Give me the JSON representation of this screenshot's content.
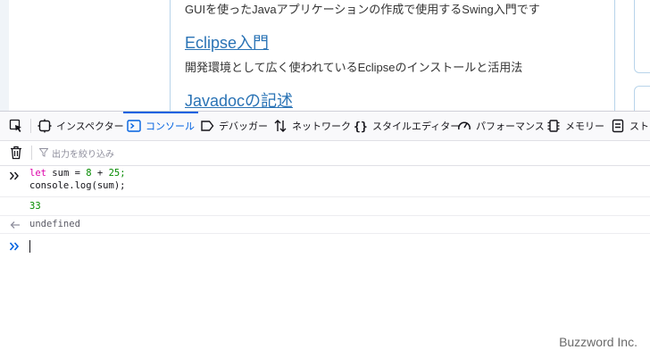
{
  "page": {
    "lines": [
      {
        "kind": "text",
        "value": "GUIを使ったJavaアプリケーションの作成で使用するSwing入門です"
      },
      {
        "kind": "link",
        "value": "Eclipse入門"
      },
      {
        "kind": "text",
        "value": "開発環境として広く使われているEclipseのインストールと活用法"
      },
      {
        "kind": "link",
        "value": "Javadocの記述"
      }
    ]
  },
  "devtools": {
    "tabs": [
      {
        "label": "インスペクター",
        "icon": "inspector-icon",
        "selected": false
      },
      {
        "label": "コンソール",
        "icon": "console-icon",
        "selected": true
      },
      {
        "label": "デバッガー",
        "icon": "debugger-icon",
        "selected": false
      },
      {
        "label": "ネットワーク",
        "icon": "network-icon",
        "selected": false
      },
      {
        "label": "スタイルエディター",
        "icon": "style-editor-icon",
        "selected": false
      },
      {
        "label": "パフォーマンス",
        "icon": "performance-icon",
        "selected": false
      },
      {
        "label": "メモリー",
        "icon": "memory-icon",
        "selected": false
      },
      {
        "label": "スト",
        "icon": "storage-icon",
        "selected": false
      }
    ],
    "accent_color": "#0061e0",
    "filter": {
      "placeholder": "出力を絞り込み"
    },
    "console": {
      "input_line1": {
        "kw": "let",
        "ident": "sum",
        "eq": "=",
        "a": "8",
        "plus": "+",
        "b": "25;"
      },
      "input_line2": "console.log(sum);",
      "log_output": "33",
      "result": "undefined"
    }
  },
  "watermark": "Buzzword Inc."
}
